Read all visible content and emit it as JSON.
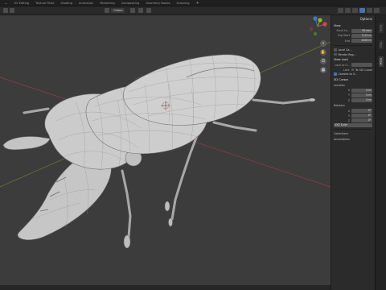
{
  "workspace_tabs": [
    "...",
    "UV Editing",
    "Texture Paint",
    "Shading",
    "Animation",
    "Rendering",
    "Compositing",
    "Geometry Nodes",
    "Scripting",
    "+"
  ],
  "active_tab_index": 0,
  "header": {
    "orientation_label": "Global",
    "shading_modes": [
      "wireframe",
      "solid",
      "material",
      "rendered"
    ],
    "active_shading": "solid"
  },
  "sidebar": {
    "options_label": "Options",
    "view_title": "View",
    "focal_length_label": "Focal Le...",
    "focal_length_value": "50 mm",
    "clip_start_label": "Clip Start",
    "clip_start_value": "0.01 m",
    "clip_end_label": "End",
    "clip_end_value": "1000 m",
    "use_local_camera_label": "Local Ca...",
    "render_region_label": "Render Reg...",
    "view_lock_title": "View Lock",
    "lock_to_object_label": "Lock to O...",
    "lock_label": "Lock",
    "lock_value": "To 3D Cursor",
    "camera_to_view_label": "Camera to V...",
    "cursor_title": "3D Cursor",
    "location_label": "Location",
    "loc_x_label": "X",
    "loc_x_value": "0 m",
    "loc_y_label": "Y",
    "loc_y_value": "0 m",
    "loc_z_label": "Z",
    "loc_z_value": "0 m",
    "rotation_label": "Rotation",
    "rot_x_label": "X",
    "rot_x_value": "0°",
    "rot_y_label": "Y",
    "rot_y_value": "0°",
    "rot_z_label": "Z",
    "rot_z_value": "0°",
    "rotation_mode_value": "XYZ Euler",
    "collections_label": "Collections",
    "annotations_label": "Annotations"
  },
  "sidebar_tabs": [
    "Item",
    "Tool",
    "View"
  ],
  "active_sidebar_tab": "View",
  "navigation_icons": [
    "zoom-icon",
    "hand-pan-icon",
    "camera-view-icon",
    "grid-view-icon"
  ],
  "colors": {
    "viewport_bg": "#3c3c3c",
    "mesh_fill": "#c9c9c9",
    "wire": "#6f6f6f",
    "x_axis": "#b3474d",
    "y_axis": "#7a9a2e",
    "accent": "#4772b3"
  }
}
